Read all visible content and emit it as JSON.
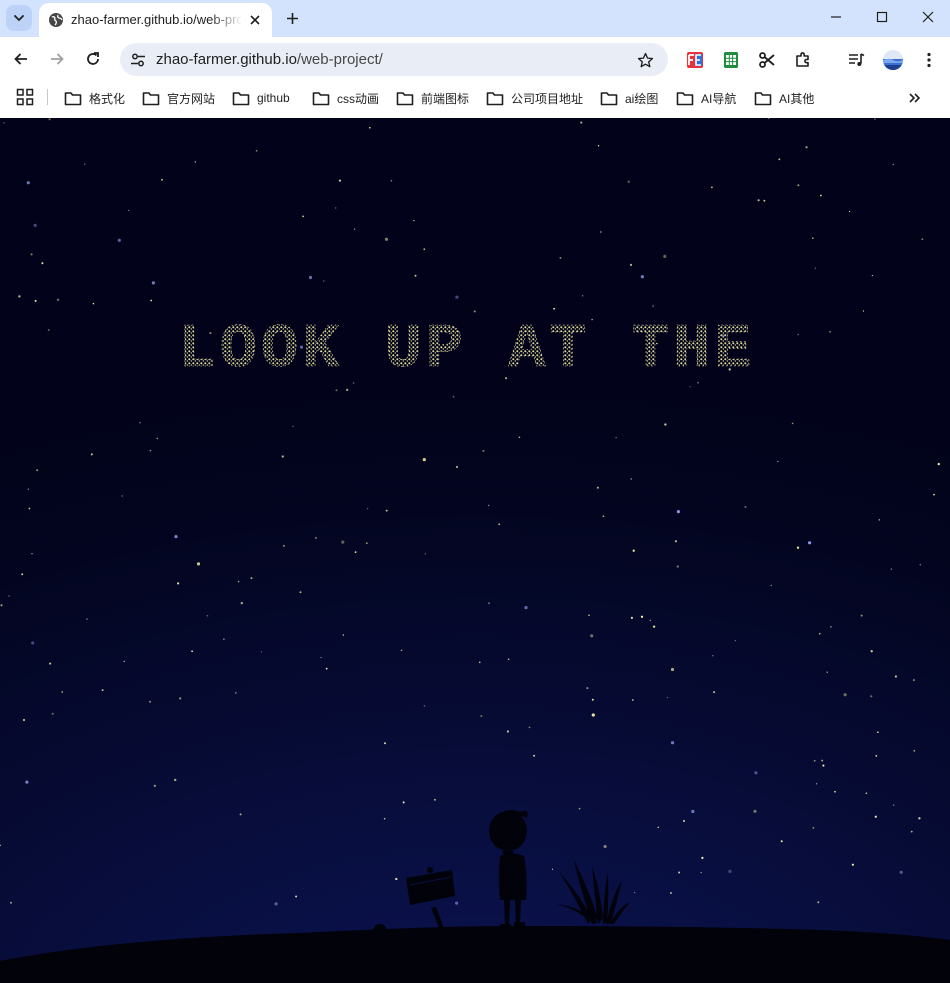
{
  "browser": {
    "tab_title": "zhao-farmer.github.io/web-project/",
    "url_host": "zhao-farmer.github.io",
    "url_path": "/web-project/",
    "icons": {
      "tab_search": "chevron-down-icon",
      "tab_favicon": "globe-icon",
      "tab_close": "close-icon",
      "new_tab": "plus-icon",
      "minimize": "minimize-icon",
      "maximize": "maximize-icon",
      "close_window": "close-icon",
      "back": "arrow-left-icon",
      "forward": "arrow-right-icon",
      "reload": "reload-icon",
      "site_info": "tune-icon",
      "bookmark_star": "star-icon",
      "extensions": [
        "fe-extension-icon",
        "sheets-extension-icon",
        "scissors-extension-icon",
        "puzzle-icon",
        "media-icon",
        "profile-avatar-icon",
        "more-vert-icon"
      ]
    }
  },
  "bookmarks": {
    "items": [
      {
        "label": "格式化"
      },
      {
        "label": "官方网站"
      },
      {
        "label": "github"
      },
      {
        "label": "css动画"
      },
      {
        "label": "前端图标"
      },
      {
        "label": "公司项目地址"
      },
      {
        "label": "ai绘图"
      },
      {
        "label": "AI导航"
      },
      {
        "label": "AI其他"
      }
    ],
    "apps_icon": "apps-grid-icon",
    "folder_icon": "folder-icon",
    "more_icon": "double-chevron-right-icon"
  },
  "page": {
    "headline": "LOOK UP AT THE",
    "colors": {
      "sky_top": "#02031a",
      "sky_bottom": "#0c1556",
      "star": "#f4f0a8",
      "star_blue": "#8f9be8",
      "ground": "#01020a"
    },
    "scene": [
      "boy-silhouette",
      "signpost-silhouette",
      "grass-silhouette",
      "ground-hill"
    ]
  },
  "theme": {
    "tabstrip_bg": "#d3e3fd",
    "omnibox_bg": "#e9eef6",
    "text": "#1f1f1f"
  }
}
